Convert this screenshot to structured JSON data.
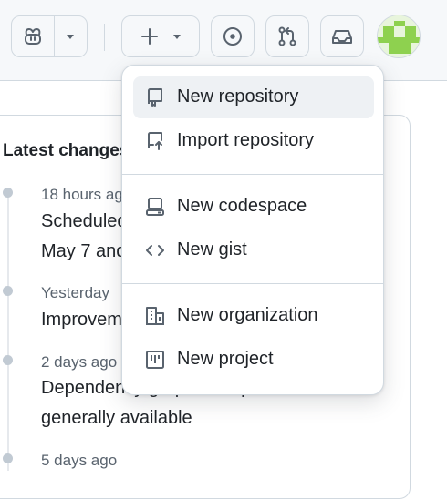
{
  "header": {
    "copilot_icon": "copilot-icon",
    "create_icon": "plus-icon",
    "issues_icon": "issue-opened-icon",
    "pulls_icon": "git-pull-request-icon",
    "inbox_icon": "inbox-icon",
    "avatar": "user-avatar"
  },
  "changelog": {
    "heading": "Latest changes",
    "entries": [
      {
        "time": "18 hours ago",
        "lines": [
          "Scheduled",
          "May 7 and"
        ]
      },
      {
        "time": "Yesterday",
        "lines": [
          "Improvem"
        ]
      },
      {
        "time": "2 days ago",
        "lines": [
          "Dependency graph deduplication is now",
          "generally available"
        ]
      },
      {
        "time": "5 days ago",
        "lines": []
      }
    ]
  },
  "create_menu": {
    "items": [
      {
        "label": "New repository",
        "icon": "repo-icon"
      },
      {
        "label": "Import repository",
        "icon": "repo-push-icon"
      },
      {
        "label": "New codespace",
        "icon": "codespaces-icon"
      },
      {
        "label": "New gist",
        "icon": "code-icon"
      },
      {
        "label": "New organization",
        "icon": "organization-icon"
      },
      {
        "label": "New project",
        "icon": "project-icon"
      }
    ]
  },
  "colors": {
    "accent_bg": "#f6f8fa",
    "border": "#d1d9e0",
    "text": "#1f2328",
    "muted": "#59636e",
    "avatar_green": "#8ed14f"
  }
}
